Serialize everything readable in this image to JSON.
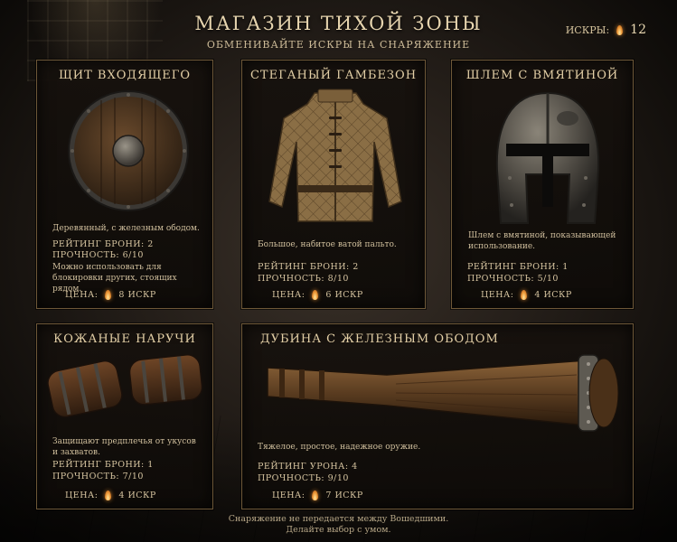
{
  "shop": {
    "title": "МАГАЗИН ТИХОЙ ЗОНЫ",
    "subtitle": "ОБМЕНИВАЙТЕ ИСКРЫ НА СНАРЯЖЕНИЕ",
    "currency_label": "ИСКРЫ:",
    "currency_amount": "12",
    "currency_icon": "flame-icon"
  },
  "items": [
    {
      "name": "ЩИТ ВХОДЯЩЕГО",
      "description": "Деревянный, с железным ободом.",
      "stat1": "РЕЙТИНГ БРОНИ: 2",
      "stat2": "ПРОЧНОСТЬ: 6/10",
      "extra": "Можно использовать для блокировки других, стоящих рядом.",
      "price_label": "ЦЕНА:",
      "price": "8 ИСКР"
    },
    {
      "name": "СТЕГАНЫЙ ГАМБЕЗОН",
      "description": "Большое, набитое ватой пальто.",
      "stat1": "РЕЙТИНГ БРОНИ: 2",
      "stat2": "ПРОЧНОСТЬ: 8/10",
      "price_label": "ЦЕНА:",
      "price": "6 ИСКР"
    },
    {
      "name": "ШЛЕМ С ВМЯТИНОЙ",
      "description": "Шлем с вмятиной, показывающей использование.",
      "stat1": "РЕЙТИНГ БРОНИ: 1",
      "stat2": "ПРОЧНОСТЬ: 5/10",
      "price_label": "ЦЕНА:",
      "price": "4 ИСКР"
    },
    {
      "name": "КОЖАНЫЕ НАРУЧИ",
      "description": "Защищают предплечья от укусов и захватов.",
      "stat1": "РЕЙТИНГ БРОНИ: 1",
      "stat2": "ПРОЧНОСТЬ: 7/10",
      "price_label": "ЦЕНА:",
      "price": "4 ИСКР"
    },
    {
      "name": "ДУБИНА С ЖЕЛЕЗНЫМ ОБОДОМ",
      "description": "Тяжелое, простое, надежное оружие.",
      "stat1": "РЕЙТИНГ УРОНА: 4",
      "stat2": "ПРОЧНОСТЬ: 9/10",
      "price_label": "ЦЕНА:",
      "price": "7 ИСКР"
    }
  ],
  "footer": {
    "line1": "Снаряжение не передается между Вошедшими.",
    "line2": "Делайте выбор с умом."
  },
  "colors": {
    "accent": "#d6a24a",
    "border": "#6e5838",
    "text": "#d8c8a6"
  }
}
